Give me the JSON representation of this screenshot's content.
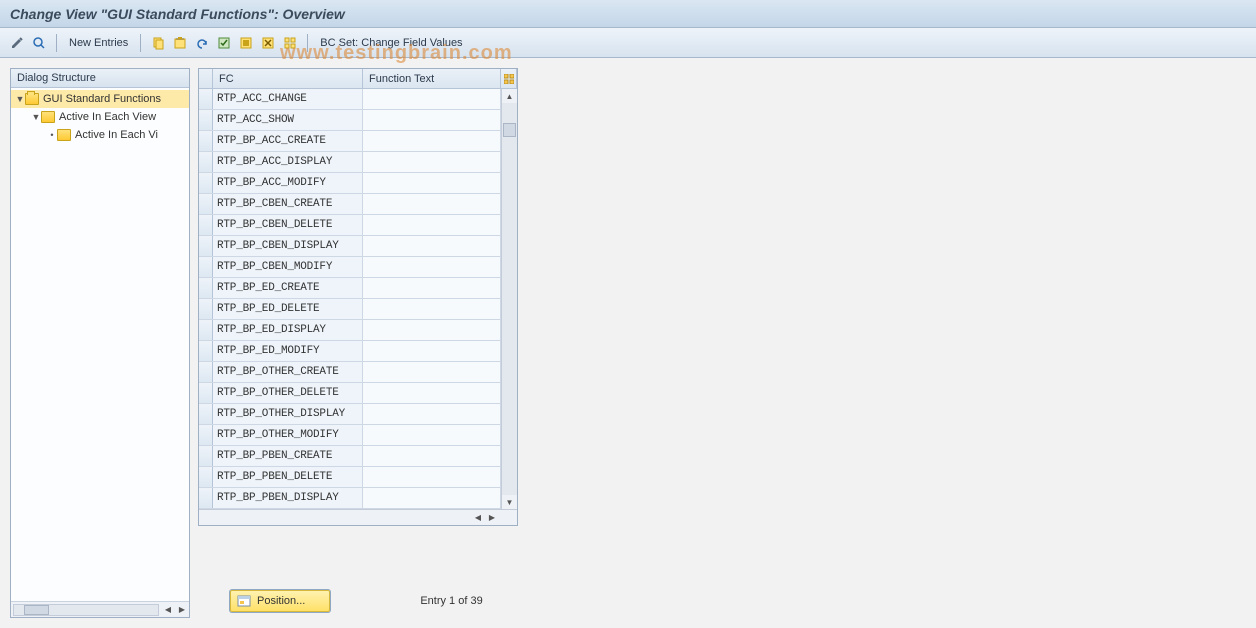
{
  "title": "Change View \"GUI Standard Functions\": Overview",
  "toolbar": {
    "new_entries": "New Entries",
    "bcset": "BC Set: Change Field Values"
  },
  "tree": {
    "header": "Dialog Structure",
    "nodes": [
      {
        "label": "GUI Standard Functions",
        "depth": 0,
        "selected": true,
        "open": true
      },
      {
        "label": "Active In Each View",
        "depth": 1,
        "selected": false,
        "open": false
      },
      {
        "label": "Active In Each Vi",
        "depth": 2,
        "selected": false,
        "open": false
      }
    ]
  },
  "table": {
    "col_fc": "FC",
    "col_ft": "Function Text",
    "rows": [
      {
        "fc": "RTP_ACC_CHANGE",
        "ft": ""
      },
      {
        "fc": "RTP_ACC_SHOW",
        "ft": ""
      },
      {
        "fc": "RTP_BP_ACC_CREATE",
        "ft": ""
      },
      {
        "fc": "RTP_BP_ACC_DISPLAY",
        "ft": ""
      },
      {
        "fc": "RTP_BP_ACC_MODIFY",
        "ft": ""
      },
      {
        "fc": "RTP_BP_CBEN_CREATE",
        "ft": ""
      },
      {
        "fc": "RTP_BP_CBEN_DELETE",
        "ft": ""
      },
      {
        "fc": "RTP_BP_CBEN_DISPLAY",
        "ft": ""
      },
      {
        "fc": "RTP_BP_CBEN_MODIFY",
        "ft": ""
      },
      {
        "fc": "RTP_BP_ED_CREATE",
        "ft": ""
      },
      {
        "fc": "RTP_BP_ED_DELETE",
        "ft": ""
      },
      {
        "fc": "RTP_BP_ED_DISPLAY",
        "ft": ""
      },
      {
        "fc": "RTP_BP_ED_MODIFY",
        "ft": ""
      },
      {
        "fc": "RTP_BP_OTHER_CREATE",
        "ft": ""
      },
      {
        "fc": "RTP_BP_OTHER_DELETE",
        "ft": ""
      },
      {
        "fc": "RTP_BP_OTHER_DISPLAY",
        "ft": ""
      },
      {
        "fc": "RTP_BP_OTHER_MODIFY",
        "ft": ""
      },
      {
        "fc": "RTP_BP_PBEN_CREATE",
        "ft": ""
      },
      {
        "fc": "RTP_BP_PBEN_DELETE",
        "ft": ""
      },
      {
        "fc": "RTP_BP_PBEN_DISPLAY",
        "ft": ""
      }
    ]
  },
  "footer": {
    "position_btn": "Position...",
    "entry_text": "Entry 1 of 39"
  },
  "watermark": "www.testingbrain.com"
}
